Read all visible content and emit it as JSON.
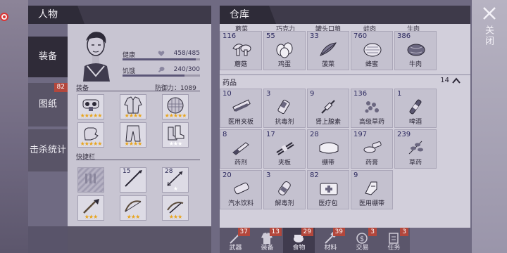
{
  "left_panel": {
    "title": "人物",
    "side_tabs": [
      {
        "label": "装备",
        "active": true
      },
      {
        "label": "图纸",
        "badge": "82"
      },
      {
        "label": "击杀统计"
      }
    ],
    "stats": [
      {
        "label": "健康",
        "value": "458/485",
        "fraction": 0.944
      },
      {
        "label": "饥饿",
        "value": "240/300",
        "fraction": 0.8
      }
    ],
    "equipment_label": "装备",
    "defense_label": "防御力：1089",
    "quickbar_label": "快捷栏",
    "equipment": [
      {
        "icon": "mask-icon",
        "stars": "★★★★★"
      },
      {
        "icon": "jacket-icon",
        "stars": "★★★★"
      },
      {
        "icon": "helmet-icon",
        "stars": "★★★★★"
      },
      {
        "icon": "gloves-icon",
        "stars": "★★★★★"
      },
      {
        "icon": "pants-icon",
        "stars": "★★★★"
      },
      {
        "icon": "boots-icon",
        "stars": "★★★",
        "white": true
      }
    ],
    "quickbar": [
      {
        "icon": "locked-slot-icon",
        "count": "",
        "stars": ""
      },
      {
        "icon": "spear-icon",
        "count": "15",
        "stars": ""
      },
      {
        "icon": "arrow-icon",
        "count": "28",
        "stars": "★",
        "white": true
      },
      {
        "icon": "shovel-icon",
        "count": "",
        "stars": "★★★"
      },
      {
        "icon": "bow-icon",
        "count": "",
        "stars": "★★★"
      },
      {
        "icon": "crossbow-icon",
        "count": "",
        "stars": "★★★"
      }
    ]
  },
  "right_panel": {
    "title": "仓库",
    "top_cut_labels": [
      "蘑菜",
      "巧克力",
      "罐头口粮",
      "蛙肉",
      "生肉"
    ],
    "food_row": [
      {
        "count": "116",
        "name": "蘑菇",
        "icon": "mushroom-icon"
      },
      {
        "count": "55",
        "name": "鸡蛋",
        "icon": "egg-icon"
      },
      {
        "count": "33",
        "name": "菠菜",
        "icon": "spinach-icon"
      },
      {
        "count": "760",
        "name": "蜂蜜",
        "icon": "honey-icon"
      },
      {
        "count": "386",
        "name": "牛肉",
        "icon": "beef-icon"
      }
    ],
    "medicine_category": {
      "label": "药品",
      "count": "14"
    },
    "medicine": [
      {
        "count": "10",
        "name": "医用夹板",
        "icon": "medical-splint-icon"
      },
      {
        "count": "3",
        "name": "抗毒剂",
        "icon": "antidote-icon"
      },
      {
        "count": "9",
        "name": "肾上腺素",
        "icon": "adrenaline-icon"
      },
      {
        "count": "136",
        "name": "高级草药",
        "icon": "advanced-herb-icon"
      },
      {
        "count": "1",
        "name": "啤酒",
        "icon": "beer-icon"
      },
      {
        "count": "8",
        "name": "药剂",
        "icon": "potion-icon"
      },
      {
        "count": "17",
        "name": "夹板",
        "icon": "splint-icon"
      },
      {
        "count": "28",
        "name": "绷带",
        "icon": "bandage-icon"
      },
      {
        "count": "197",
        "name": "药膏",
        "icon": "ointment-icon"
      },
      {
        "count": "239",
        "name": "草药",
        "icon": "herb-icon"
      },
      {
        "count": "20",
        "name": "汽水饮料",
        "icon": "soda-icon"
      },
      {
        "count": "3",
        "name": "解毒剂",
        "icon": "detox-icon"
      },
      {
        "count": "82",
        "name": "医疗包",
        "icon": "medkit-icon"
      },
      {
        "count": "9",
        "name": "医用绷带",
        "icon": "medical-bandage-icon"
      }
    ],
    "bottom_tabs": [
      {
        "label": "武器",
        "badge": "37",
        "icon": "weapon-icon"
      },
      {
        "label": "装备",
        "badge": "13",
        "icon": "armor-icon"
      },
      {
        "label": "食物",
        "badge": "29",
        "icon": "food-icon"
      },
      {
        "label": "材料",
        "badge": "39",
        "icon": "material-icon"
      },
      {
        "label": "交易",
        "badge": "3",
        "icon": "trade-icon"
      },
      {
        "label": "任务",
        "badge": "3",
        "icon": "quest-icon"
      }
    ]
  },
  "close": {
    "label": "关闭"
  },
  "colors": {
    "star": "#e8a41c",
    "badge": "#b3473c",
    "panel_dark": "#2e2b38"
  }
}
